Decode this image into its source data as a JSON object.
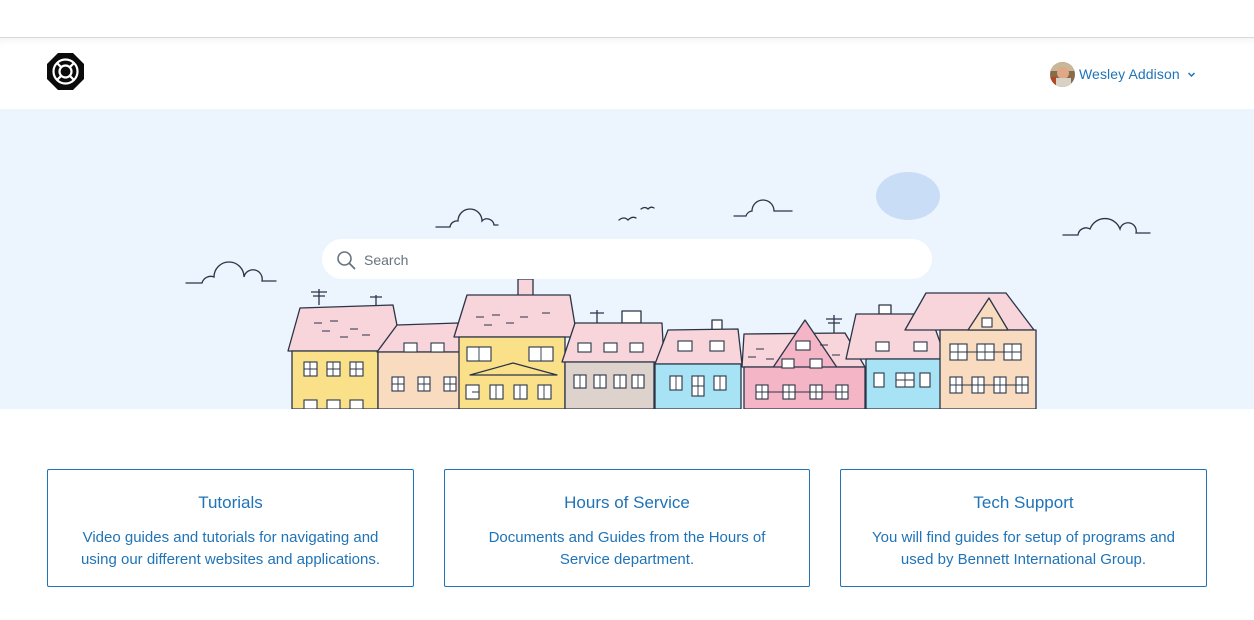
{
  "colors": {
    "accent": "#1f73b7",
    "hero_background": "#ecf4fe"
  },
  "header": {
    "logo_icon": "lifebuoy-logo-icon",
    "user": {
      "name": "Wesley Addison",
      "avatar_icon": "user-avatar",
      "menu_icon": "chevron-down-icon"
    }
  },
  "hero": {
    "illustration": "town-houses-illustration",
    "search": {
      "placeholder": "Search",
      "value": "",
      "icon": "search-icon"
    }
  },
  "categories": [
    {
      "title": "Tutorials",
      "description": "Video guides and tutorials for navigating and using our different websites and applications."
    },
    {
      "title": "Hours of Service",
      "description": "Documents and Guides from the Hours of Service department."
    },
    {
      "title": "Tech Support",
      "description": "You will find guides for setup of programs and used by Bennett International Group."
    }
  ]
}
